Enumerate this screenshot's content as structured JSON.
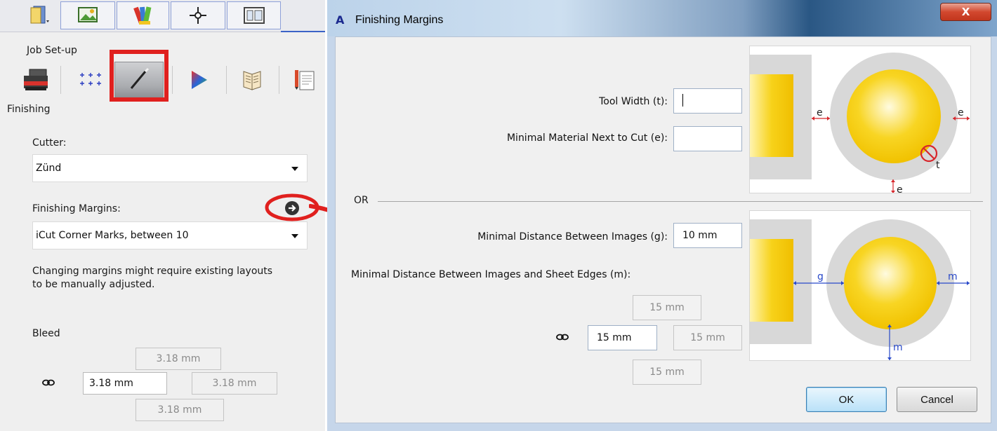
{
  "left_panel": {
    "section_job_setup": "Job Set-up",
    "section_finishing": "Finishing",
    "cutter_label": "Cutter:",
    "cutter_value": "Zünd",
    "finishing_margins_label": "Finishing Margins:",
    "finishing_margins_value": "iCut Corner Marks, between 10",
    "note": "Changing margins might require existing layouts\nto be manually adjusted.",
    "bleed_label": "Bleed",
    "bleed": {
      "top": "3.18 mm",
      "left": "3.18 mm",
      "right": "3.18 mm",
      "bottom": "3.18 mm"
    },
    "toolbar_icons": [
      "book-icon",
      "image-icon",
      "swatches-icon",
      "target-icon",
      "layout-icon"
    ],
    "tabs": [
      {
        "icon": "printer-icon"
      },
      {
        "icon": "grid-icon"
      },
      {
        "icon": "knife-icon",
        "active": true
      },
      {
        "icon": "color-triangle-icon"
      },
      {
        "icon": "booklet-icon"
      },
      {
        "icon": "document-icon"
      }
    ]
  },
  "dialog": {
    "title": "Finishing Margins",
    "app_icon": "A",
    "close_label": "X",
    "tool_width_label": "Tool Width (t):",
    "tool_width_value": "",
    "min_material_label": "Minimal Material Next to Cut (e):",
    "min_material_value": "",
    "or_label": "OR",
    "min_distance_label": "Minimal Distance Between Images (g):",
    "min_distance_value": "10 mm",
    "sheet_edges_label": "Minimal Distance Between Images and Sheet Edges (m):",
    "sheet_edges": {
      "top": "15 mm",
      "left": "15 mm",
      "right": "15 mm",
      "bottom": "15 mm"
    },
    "diagram_top_labels": {
      "e_left": "e",
      "e_right": "e",
      "e_bottom": "e",
      "t": "t"
    },
    "diagram_bottom_labels": {
      "g": "g",
      "m_right": "m",
      "m_bottom": "m"
    },
    "ok_label": "OK",
    "cancel_label": "Cancel"
  },
  "colors": {
    "highlight_red": "#e0201e",
    "gold": "#f5cf11",
    "diagram_gray": "#d8d8d8",
    "dimension_red": "#d7262b",
    "dimension_blue": "#2949c9"
  }
}
